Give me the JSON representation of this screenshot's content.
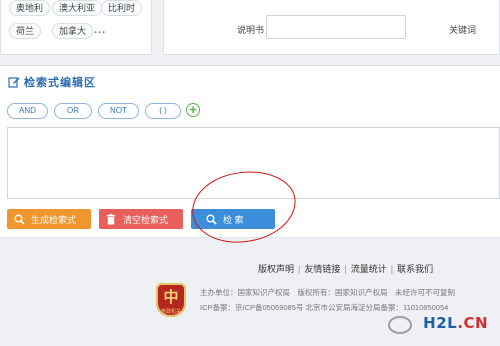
{
  "countries": [
    "奥地利",
    "澳大利亚",
    "比利时",
    "荷兰",
    "加拿大"
  ],
  "more_label": "...",
  "form": {
    "manual_label": "说明书",
    "manual_value": "",
    "keyword_label": "关键词"
  },
  "editor": {
    "title": "检索式编辑区",
    "operators": [
      "AND",
      "OR",
      "NOT",
      "( )"
    ],
    "add_symbol": "+",
    "query_value": "",
    "buttons": {
      "generate": "生成检索式",
      "clear": "清空检索式",
      "search": "检 索"
    }
  },
  "footer": {
    "links": [
      "版权声明",
      "友情链接",
      "流量统计",
      "联系我们"
    ],
    "sponsor": "主办单位：国家知识产权局　版权所有：国家知识产权局　未经许可不可复制",
    "icp": "ICP备案：京ICP备05069085号 北京市公安局海淀分局备案：11010850054",
    "emblem_char": "中",
    "emblem_text": "党政机关"
  },
  "watermark": {
    "prefix": "H2L",
    "dot": ".",
    "suffix": "CN"
  },
  "colors": {
    "generate": "#f0962e",
    "clear": "#e85f5b",
    "search": "#3c8edb",
    "annotation": "#d01616"
  }
}
